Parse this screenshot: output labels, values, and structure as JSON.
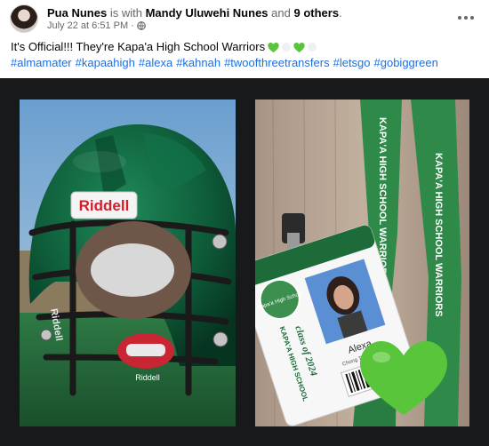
{
  "post": {
    "author": "Pua Nunes",
    "with_text": "is with",
    "tagged_person": "Mandy Uluwehi Nunes",
    "and_text": "and",
    "others": "9 others",
    "period": ".",
    "timestamp": "July 22 at 6:51 PM",
    "dot": "·",
    "message": "It's Official!!! They're  Kapa'a High School Warriors",
    "hashtags": [
      "#almamater",
      "#kapaahigh",
      "#alexa",
      "#kahnah",
      "#twoofthreetransfers",
      "#letsgo",
      "#gobiggreen"
    ]
  },
  "photos": {
    "helmet": {
      "brand_text": "Riddell",
      "side_text": "Riddell",
      "chin_text": "Riddell"
    },
    "id_card": {
      "class_text": "class of 2024",
      "school_text": "KAPA'A HIGH SCHOOL",
      "card_name": "Alexa",
      "card_subname": "Chong Tim Kahapi",
      "lanyard_text": "KAPA'A HIGH SCHOOL WARRIORS",
      "seal_text": "Kapa'a High School"
    }
  },
  "colors": {
    "link": "#216fdb",
    "muted": "#65676b",
    "helmet_green": "#0e5c39",
    "lanyard_green": "#2f8a4a",
    "heart_green": "#58c53a",
    "photo_bg": "#18191a"
  },
  "icons": {
    "globe": "globe-icon",
    "more": "more-icon",
    "heart": "green-heart-emoji"
  }
}
